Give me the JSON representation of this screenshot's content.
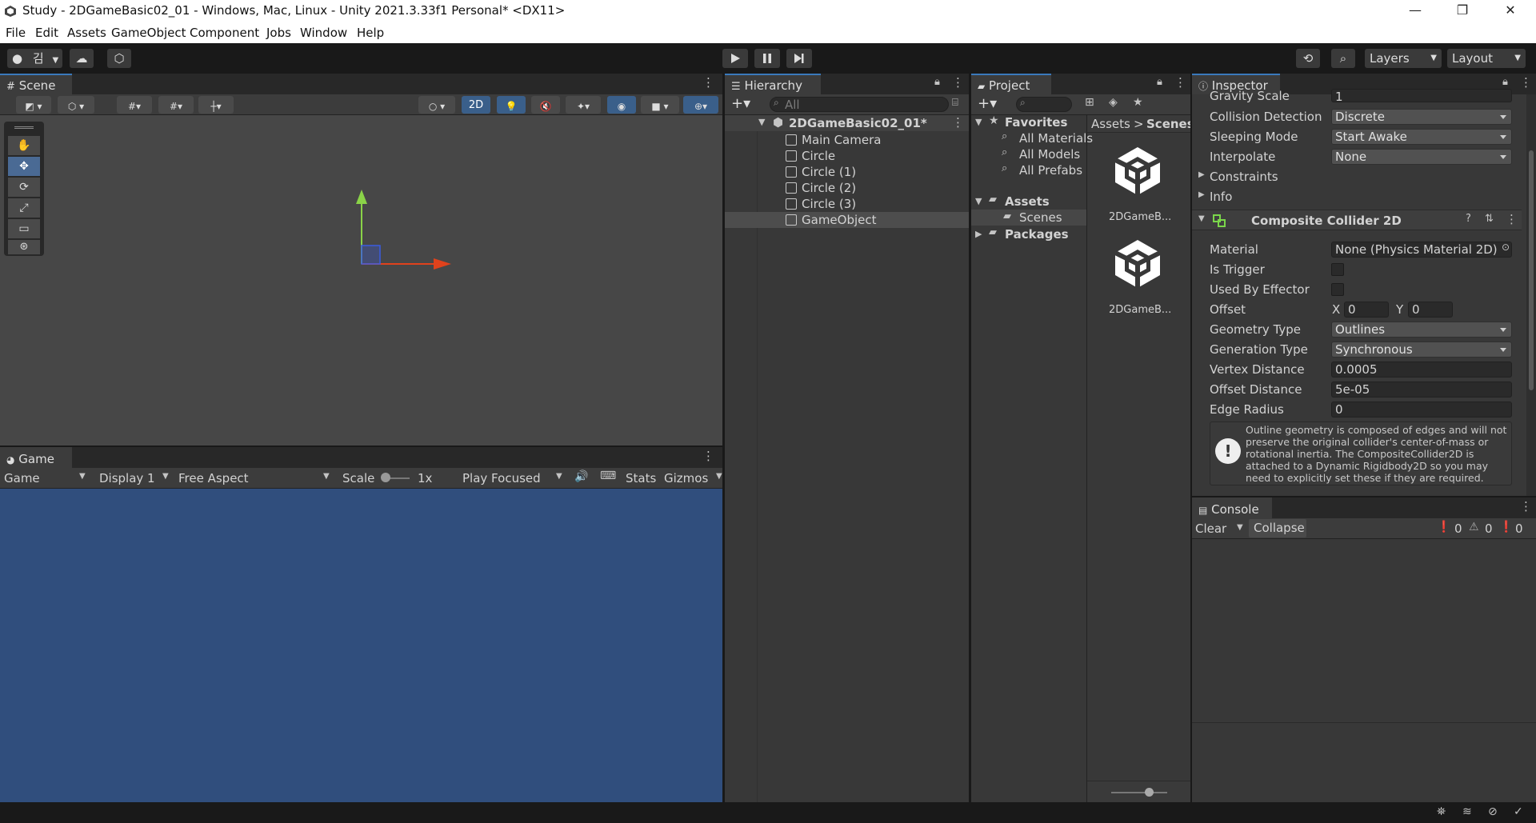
{
  "window": {
    "title": "Study - 2DGameBasic02_01 - Windows, Mac, Linux - Unity 2021.3.33f1 Personal* <DX11>",
    "minimize": "—",
    "maximize": "❐",
    "close": "✕"
  },
  "menu": [
    "File",
    "Edit",
    "Assets",
    "GameObject",
    "Component",
    "Jobs",
    "Window",
    "Help"
  ],
  "toolbar": {
    "account_label": "김",
    "layers_label": "Layers",
    "layout_label": "Layout"
  },
  "scene": {
    "tab_label": "Scene",
    "mode_2d": "2D"
  },
  "game": {
    "tab_label": "Game",
    "view_select": "Game",
    "display_select": "Display 1",
    "aspect_select": "Free Aspect",
    "scale_label": "Scale",
    "scale_value": "1x",
    "play_mode": "Play Focused",
    "stats_label": "Stats",
    "gizmos_label": "Gizmos",
    "background": "#304e7d"
  },
  "hierarchy": {
    "tab_label": "Hierarchy",
    "search_placeholder": "All",
    "scene_name": "2DGameBasic02_01*",
    "items": [
      "Main Camera",
      "Circle",
      "Circle (1)",
      "Circle (2)",
      "Circle (3)",
      "GameObject"
    ],
    "selected_item": "GameObject"
  },
  "project": {
    "tab_label": "Project",
    "favorites_label": "Favorites",
    "favorites": [
      "All Materials",
      "All Models",
      "All Prefabs"
    ],
    "assets_label": "Assets",
    "scenes_label": "Scenes",
    "packages_label": "Packages",
    "breadcrumb": [
      "Assets",
      "Scenes"
    ],
    "files": [
      "2DGameB...",
      "2DGameB..."
    ]
  },
  "inspector": {
    "tab_label": "Inspector",
    "rigidbody": {
      "gravity_scale_label": "Gravity Scale",
      "gravity_scale_value": "1",
      "collision_detection_label": "Collision Detection",
      "collision_detection_value": "Discrete",
      "sleeping_mode_label": "Sleeping Mode",
      "sleeping_mode_value": "Start Awake",
      "interpolate_label": "Interpolate",
      "interpolate_value": "None",
      "constraints_label": "Constraints",
      "info_label": "Info"
    },
    "composite": {
      "header": "Composite Collider 2D",
      "material_label": "Material",
      "material_value": "None (Physics Material 2D)",
      "is_trigger_label": "Is Trigger",
      "used_by_effector_label": "Used By Effector",
      "offset_label": "Offset",
      "offset_x_label": "X",
      "offset_x": "0",
      "offset_y_label": "Y",
      "offset_y": "0",
      "geometry_type_label": "Geometry Type",
      "geometry_type_value": "Outlines",
      "generation_type_label": "Generation Type",
      "generation_type_value": "Synchronous",
      "vertex_distance_label": "Vertex Distance",
      "vertex_distance_value": "0.0005",
      "offset_distance_label": "Offset Distance",
      "offset_distance_value": "5e-05",
      "edge_radius_label": "Edge Radius",
      "edge_radius_value": "0",
      "warning": "Outline geometry is composed of edges and will not preserve the original collider's center-of-mass or rotational inertia.  The CompositeCollider2D is attached to a Dynamic Rigidbody2D so you may need to explicitly set these if they are required."
    }
  },
  "console": {
    "tab_label": "Console",
    "clear_label": "Clear",
    "collapse_label": "Collapse",
    "log_count": "0",
    "warn_count": "0",
    "error_count": "0"
  }
}
